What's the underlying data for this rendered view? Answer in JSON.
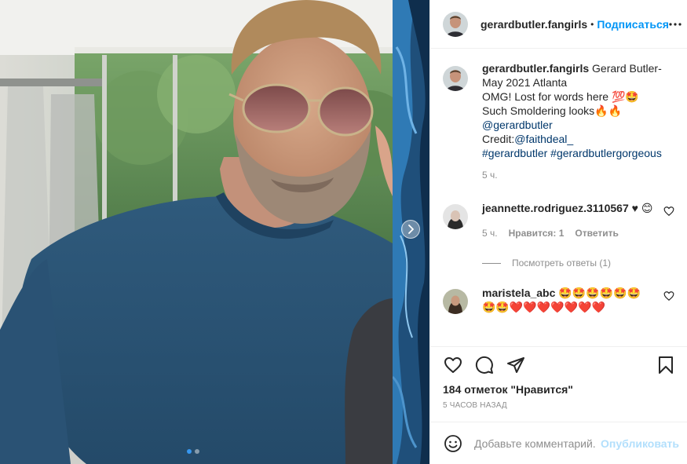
{
  "header": {
    "username": "gerardbutler.fangirls",
    "separator": "•",
    "follow_label": "Подписаться"
  },
  "caption": {
    "username": "gerardbutler.fangirls",
    "line1": "Gerard Butler-",
    "line2": "May 2021 Atlanta",
    "line3": "OMG! Lost for words here 💯🤩",
    "line4": "Such Smoldering looks🔥🔥",
    "mention": "@gerardbutler",
    "credit_prefix": "Credit:",
    "credit_mention": "@faithdeal_",
    "hashtags": "#gerardbutler #gerardbutlergorgeous",
    "time": "5 ч."
  },
  "comments": [
    {
      "username": "jeannette.rodriguez.3110567",
      "text": "♥ 😊",
      "time": "5 ч.",
      "likes": "Нравится: 1",
      "reply_label": "Ответить",
      "view_replies": "Посмотреть ответы (1)"
    },
    {
      "username": "maristela_abc",
      "text": "🤩🤩🤩🤩🤩🤩 🤩🤩❤️❤️❤️❤️❤️❤️❤️"
    }
  ],
  "likes_text": "184 отметок \"Нравится\"",
  "timestamp": "5 ЧАСОВ НАЗАД",
  "comment_input": {
    "placeholder": "Добавьте комментарий...",
    "publish_label": "Опубликовать"
  },
  "carousel": {
    "slides": 2,
    "active": 1
  },
  "colors": {
    "accent": "#0095f6",
    "link": "#00376b",
    "muted": "#8e8e8e",
    "dot_active": "#3797f0"
  }
}
